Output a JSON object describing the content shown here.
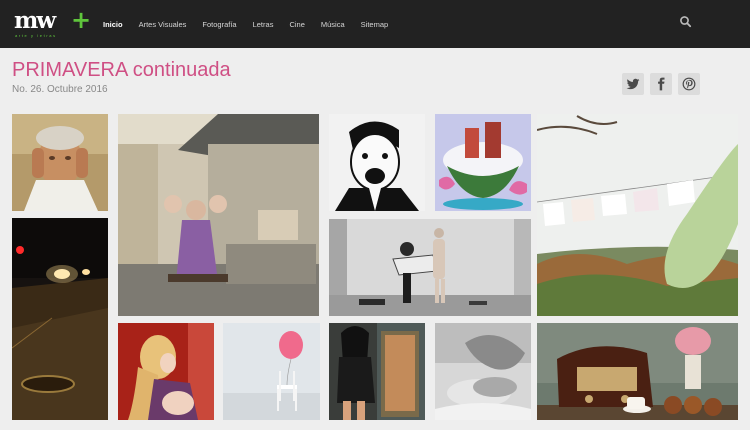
{
  "brand": {
    "logo_text": "mw",
    "logo_plus": "+",
    "tagline": "arte y letras"
  },
  "nav": {
    "items": [
      "Inicio",
      "Artes Visuales",
      "Fotografía",
      "Letras",
      "Cine",
      "Música",
      "Sitemap"
    ],
    "active": "Inicio"
  },
  "header": {
    "title": "PRIMAVERA continuada",
    "issue": "No. 26. Octubre 2016"
  },
  "share_icons": [
    "twitter-icon",
    "facebook-icon",
    "pinterest-icon"
  ],
  "colors": {
    "navbar": "#222222",
    "title_accent": "#cf4f84",
    "logo_accent": "#5fc53c",
    "background": "#eeeeee"
  },
  "gallery": [
    "painting-old-man",
    "street-night-lights",
    "girl-with-cherubs",
    "man-shouting-illustration",
    "floating-island-illustration",
    "couple-dressing",
    "clothesline-landscape",
    "mother-and-baby",
    "chair-with-balloon",
    "woman-with-fridge-painting",
    "sleeping-figure-bw",
    "vintage-radio-still-life"
  ]
}
